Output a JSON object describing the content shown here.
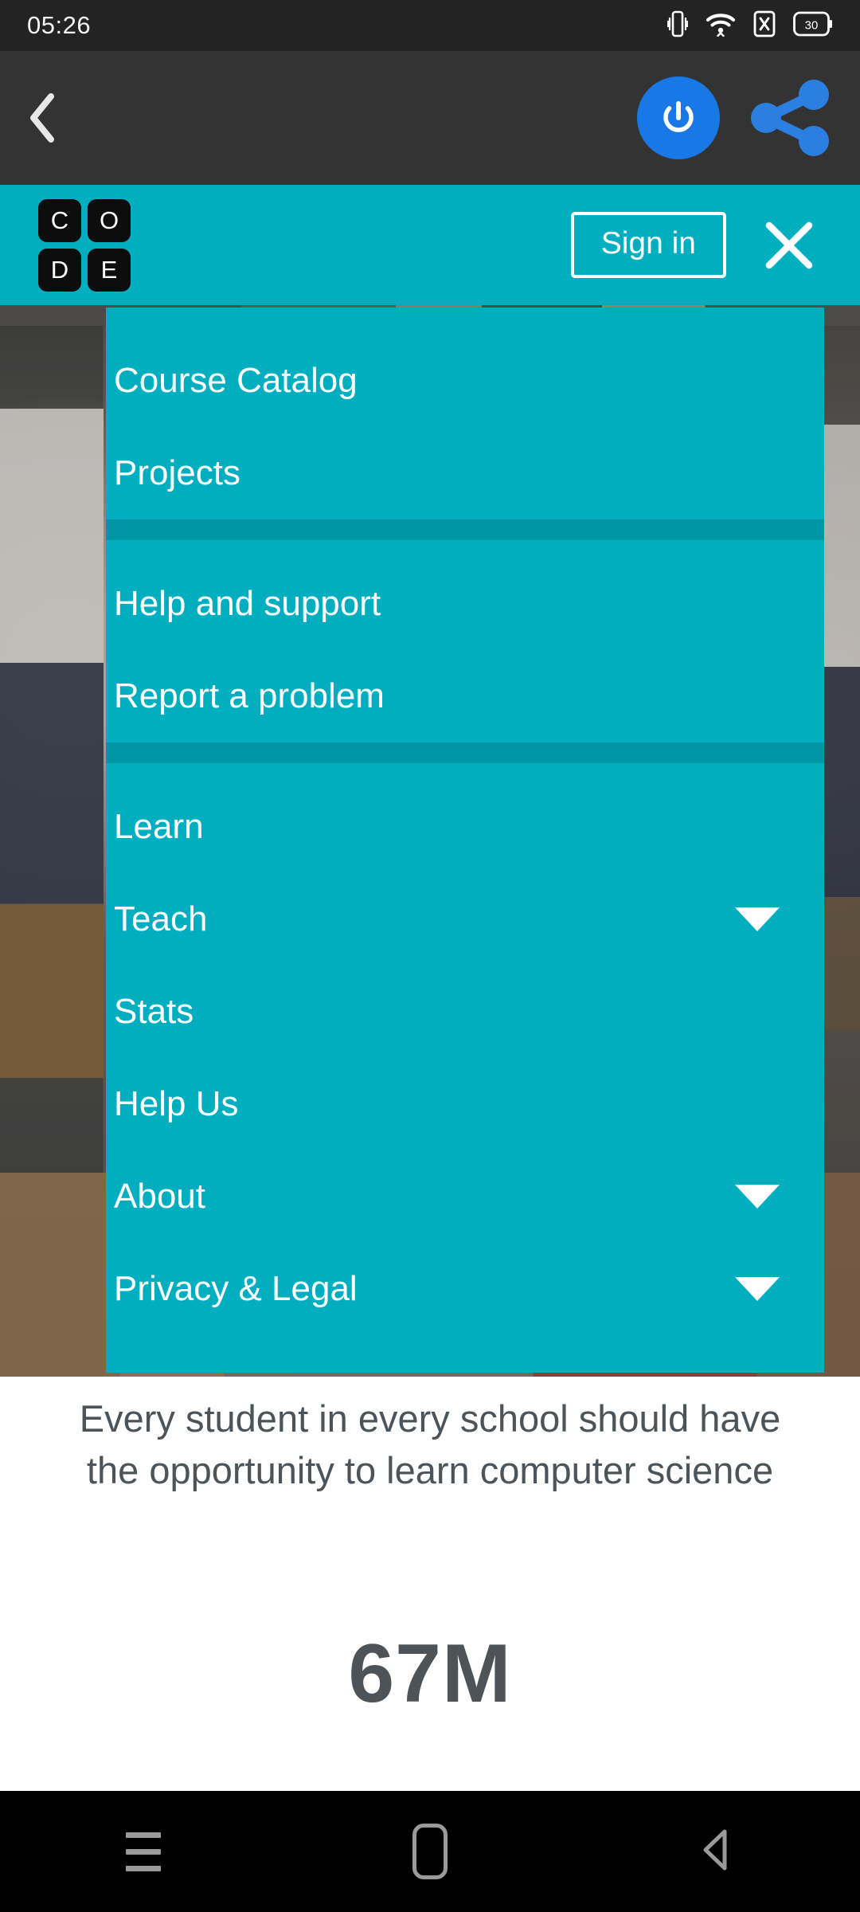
{
  "status_bar": {
    "time": "05:26",
    "icons": [
      "vibrate-icon",
      "wifi-icon",
      "no-sim-icon",
      "battery-icon"
    ],
    "battery_level": "30"
  },
  "app_toolbar": {
    "back_label": "back-chevron",
    "power_button_label": "power-icon",
    "share_button_label": "share-icon",
    "accent_color": "#1879e6",
    "background_color": "#333333"
  },
  "site_header": {
    "logo_letters": [
      "C",
      "O",
      "D",
      "E"
    ],
    "sign_in_label": "Sign in",
    "close_label": "close-icon",
    "background_color": "#00aec0"
  },
  "menu": {
    "background_color": "#00aec0",
    "divider_color": "#0096a5",
    "groups": [
      {
        "items": [
          {
            "label": "Course Catalog",
            "has_caret": false
          },
          {
            "label": "Projects",
            "has_caret": false
          }
        ]
      },
      {
        "items": [
          {
            "label": "Help and support",
            "has_caret": false
          },
          {
            "label": "Report a problem",
            "has_caret": false
          }
        ]
      },
      {
        "items": [
          {
            "label": "Learn",
            "has_caret": false
          },
          {
            "label": "Teach",
            "has_caret": true
          },
          {
            "label": "Stats",
            "has_caret": false
          },
          {
            "label": "Help Us",
            "has_caret": false
          },
          {
            "label": "About",
            "has_caret": true
          },
          {
            "label": "Privacy & Legal",
            "has_caret": true
          }
        ]
      }
    ]
  },
  "page_content": {
    "tagline": "Every student in every school should have the opportunity to learn computer science",
    "stat_value": "67M",
    "text_color": "#4d5459"
  },
  "nav_bar": {
    "recents_label": "recents-icon",
    "home_label": "home-icon",
    "back_label": "back-icon"
  }
}
